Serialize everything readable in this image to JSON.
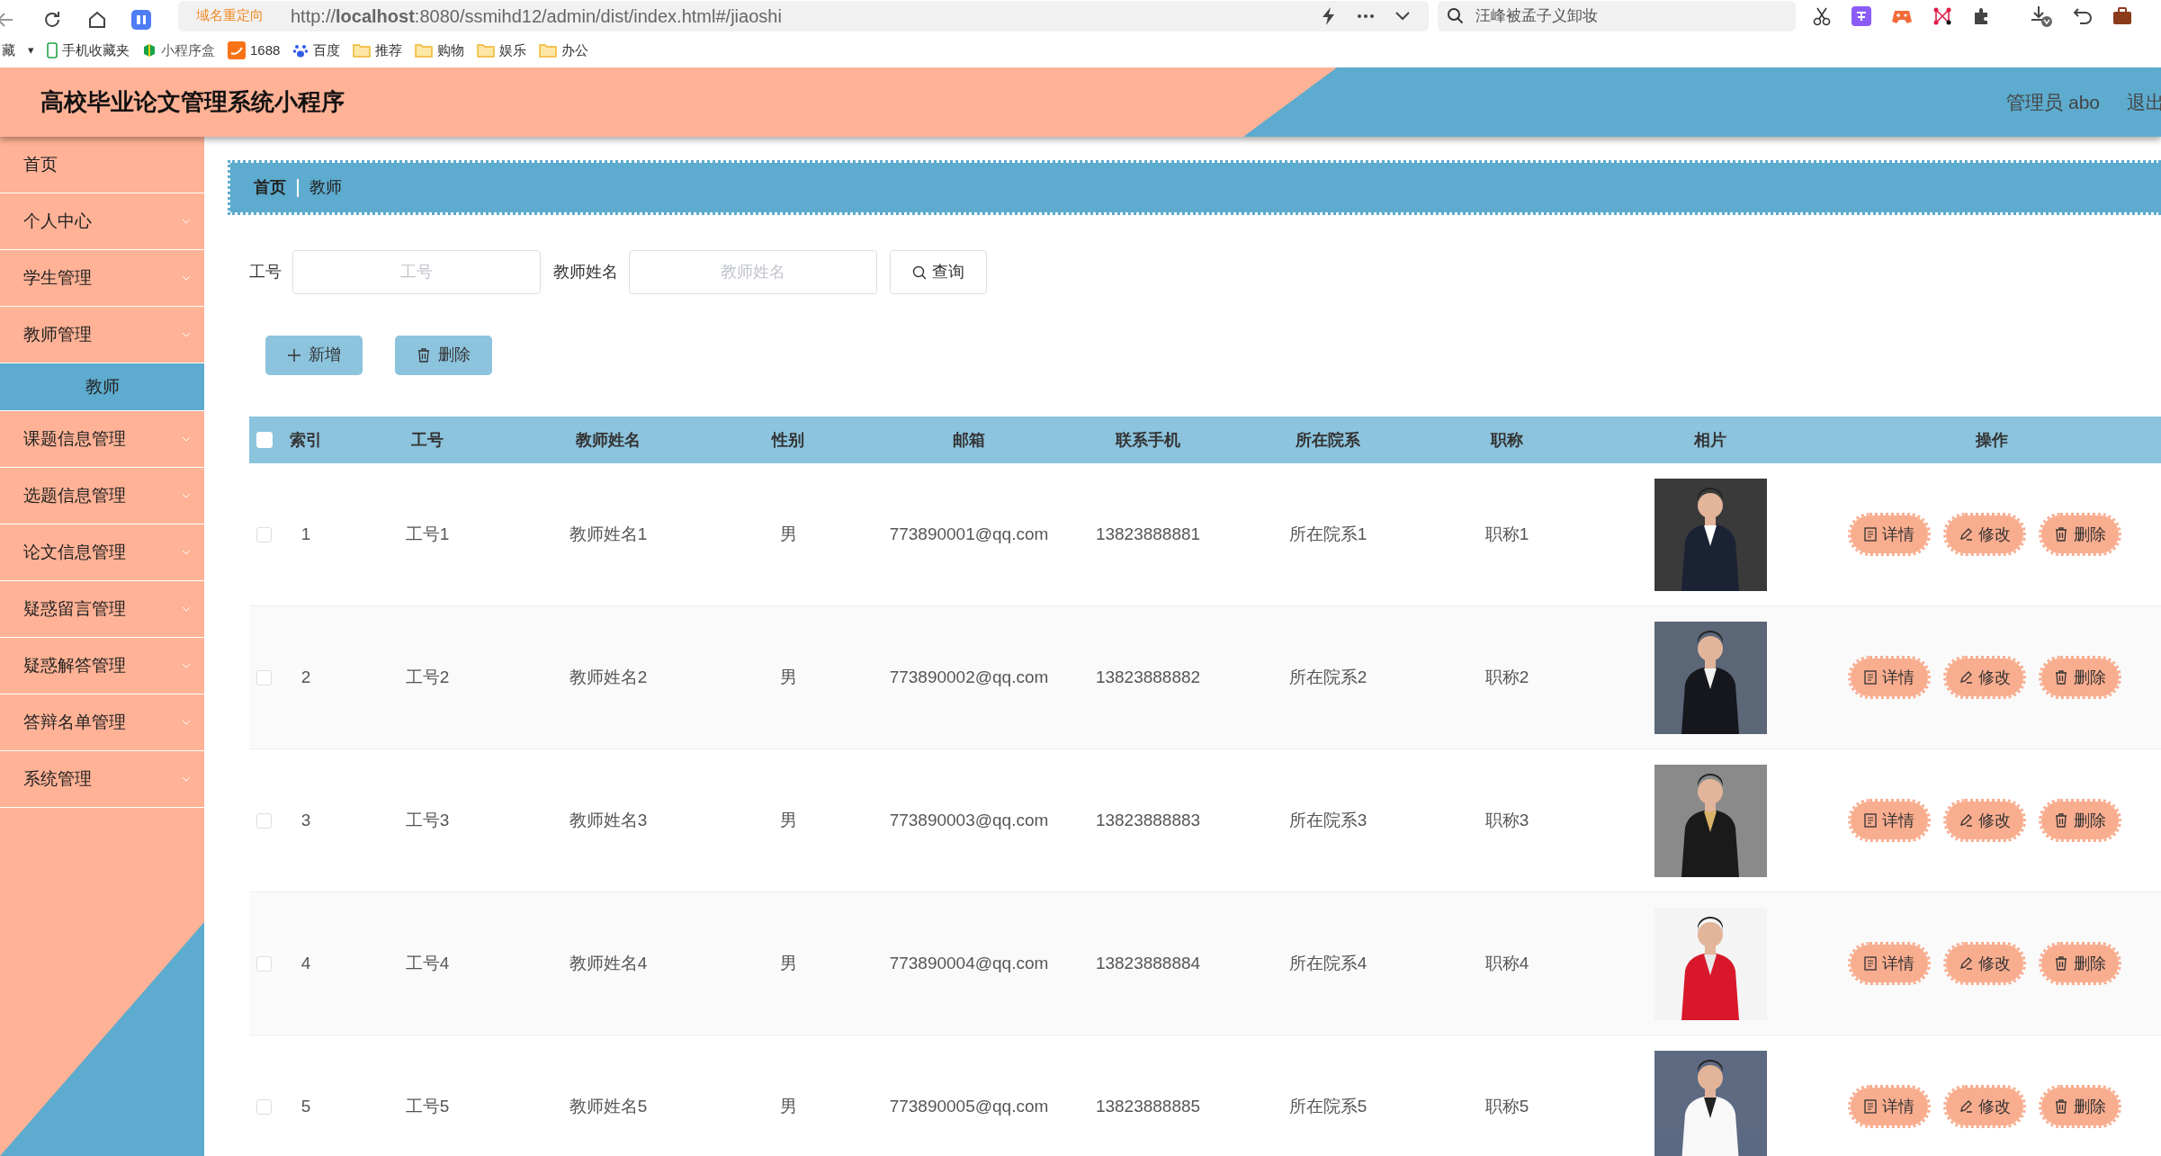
{
  "browser": {
    "redirect_label": "域名重定向",
    "url": "http://**localhost**:8080/ssmihd12/admin/dist/index.html#/jiaoshi",
    "search_text": "汪峰被孟子义卸妆",
    "bookmarks": [
      {
        "kind": "text",
        "label": "藏"
      },
      {
        "kind": "caret",
        "label": "▾"
      },
      {
        "kind": "phone",
        "label": "手机收藏夹"
      },
      {
        "kind": "box",
        "label": "小程序盒"
      },
      {
        "kind": "orange",
        "label": "1688"
      },
      {
        "kind": "paw",
        "label": "百度"
      },
      {
        "kind": "folder",
        "label": "推荐"
      },
      {
        "kind": "folder",
        "label": "购物"
      },
      {
        "kind": "folder",
        "label": "娱乐"
      },
      {
        "kind": "folder",
        "label": "办公"
      }
    ]
  },
  "header": {
    "title": "高校毕业论文管理系统小程序",
    "user": "管理员 abo",
    "logout": "退出"
  },
  "sidebar": {
    "items": [
      {
        "kind": "link",
        "label": "首页"
      },
      {
        "kind": "group",
        "label": "个人中心"
      },
      {
        "kind": "group",
        "label": "学生管理"
      },
      {
        "kind": "group",
        "label": "教师管理",
        "children": [
          {
            "label": "教师",
            "selected": true
          }
        ]
      },
      {
        "kind": "group",
        "label": "课题信息管理"
      },
      {
        "kind": "group",
        "label": "选题信息管理"
      },
      {
        "kind": "group",
        "label": "论文信息管理"
      },
      {
        "kind": "group",
        "label": "疑惑留言管理"
      },
      {
        "kind": "group",
        "label": "疑惑解答管理"
      },
      {
        "kind": "group",
        "label": "答辩名单管理"
      },
      {
        "kind": "group",
        "label": "系统管理"
      }
    ]
  },
  "breadcrumb": [
    "首页",
    "教师"
  ],
  "search": {
    "fields": [
      {
        "label": "工号",
        "placeholder": "工号"
      },
      {
        "label": "教师姓名",
        "placeholder": "教师姓名"
      }
    ],
    "button": "查询"
  },
  "actions": [
    {
      "kind": "add",
      "label": "新增"
    },
    {
      "kind": "delete",
      "label": "删除"
    }
  ],
  "table": {
    "header_checked": false,
    "columns": [
      "索引",
      "工号",
      "教师姓名",
      "性别",
      "邮箱",
      "联系手机",
      "所在院系",
      "职称",
      "相片",
      "操作"
    ],
    "rows": [
      {
        "checked": false,
        "cells": [
          "1",
          "工号1",
          "教师姓名1",
          "男",
          "773890001@qq.com",
          "13823888881",
          "所在院系1",
          "职称1"
        ],
        "buttons": [
          {
            "kind": "detail",
            "label": "详情"
          },
          {
            "kind": "edit",
            "label": "修改"
          },
          {
            "kind": "delete",
            "label": "删除"
          }
        ]
      },
      {
        "checked": false,
        "cells": [
          "2",
          "工号2",
          "教师姓名2",
          "男",
          "773890002@qq.com",
          "13823888882",
          "所在院系2",
          "职称2"
        ],
        "buttons": [
          {
            "kind": "detail",
            "label": "详情"
          },
          {
            "kind": "edit",
            "label": "修改"
          },
          {
            "kind": "delete",
            "label": "删除"
          }
        ]
      },
      {
        "checked": false,
        "cells": [
          "3",
          "工号3",
          "教师姓名3",
          "男",
          "773890003@qq.com",
          "13823888883",
          "所在院系3",
          "职称3"
        ],
        "buttons": [
          {
            "kind": "detail",
            "label": "详情"
          },
          {
            "kind": "edit",
            "label": "修改"
          },
          {
            "kind": "delete",
            "label": "删除"
          }
        ]
      },
      {
        "checked": false,
        "cells": [
          "4",
          "工号4",
          "教师姓名4",
          "男",
          "773890004@qq.com",
          "13823888884",
          "所在院系4",
          "职称4"
        ],
        "buttons": [
          {
            "kind": "detail",
            "label": "详情"
          },
          {
            "kind": "edit",
            "label": "修改"
          },
          {
            "kind": "delete",
            "label": "删除"
          }
        ]
      },
      {
        "checked": false,
        "cells": [
          "5",
          "工号5",
          "教师姓名5",
          "男",
          "773890005@qq.com",
          "13823888885",
          "所在院系5",
          "职称5"
        ],
        "buttons": [
          {
            "kind": "detail",
            "label": "详情"
          },
          {
            "kind": "edit",
            "label": "修改"
          },
          {
            "kind": "delete",
            "label": "删除"
          }
        ]
      }
    ]
  }
}
